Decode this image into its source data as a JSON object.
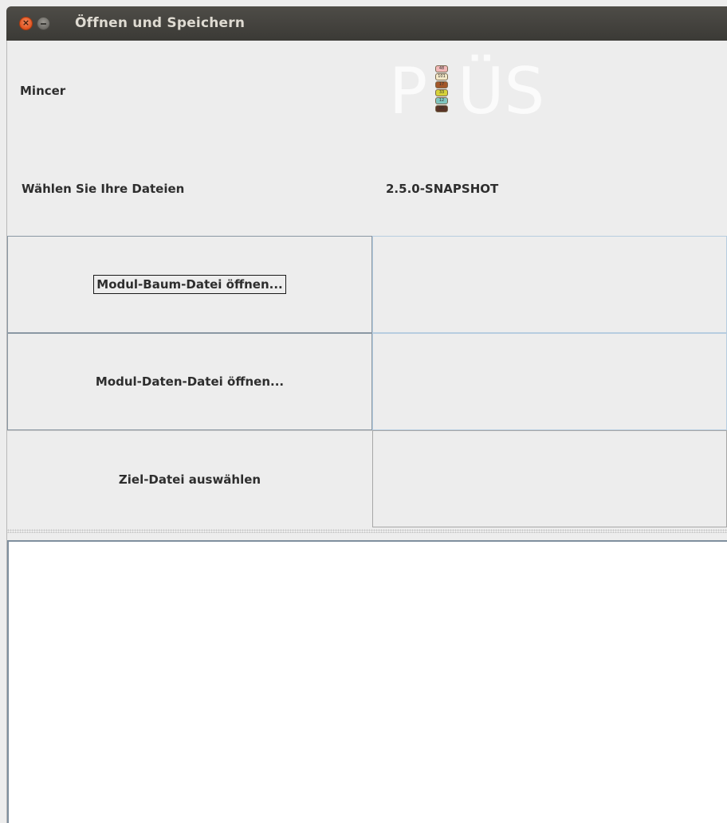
{
  "window": {
    "title": "Öffnen und Speichern",
    "close_glyph": "×"
  },
  "header": {
    "app_name": "Mincer",
    "choose_files": "Wählen Sie Ihre Dateien",
    "version": "2.5.0-SNAPSHOT",
    "logo": {
      "text_left": "P",
      "text_right": "ÜS",
      "chips": [
        {
          "label": "48",
          "color": "#f2b8b8"
        },
        {
          "label": "101",
          "color": "#f4e9c8"
        },
        {
          "label": "17",
          "color": "#a3572a"
        },
        {
          "label": "33",
          "color": "#d6d23a"
        },
        {
          "label": "12",
          "color": "#7fc6c0"
        },
        {
          "label": "05",
          "color": "#5a3527"
        }
      ]
    }
  },
  "buttons": {
    "module_tree": "Modul-Baum-Datei öffnen...",
    "module_data": "Modul-Daten-Datei öffnen...",
    "target_file": "Ziel-Datei auswählen"
  },
  "fields": {
    "module_tree_path": "",
    "module_data_path": "",
    "target_file_path": ""
  },
  "log": {
    "content": ""
  }
}
